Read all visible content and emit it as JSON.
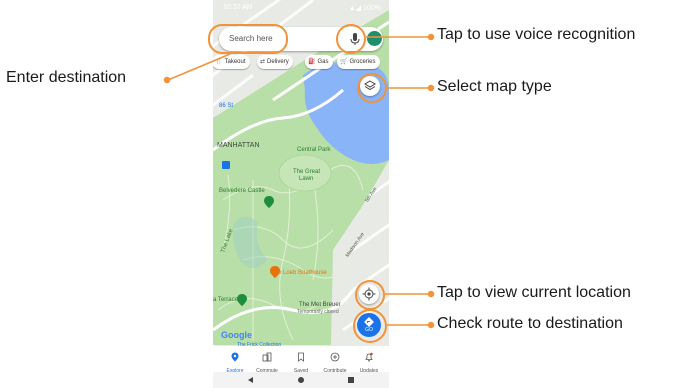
{
  "status_bar": {
    "time": "10:37 AM",
    "battery": "100%"
  },
  "search": {
    "placeholder": "Search here"
  },
  "chips": [
    {
      "icon": "restaurant-icon",
      "label": "Takeout"
    },
    {
      "icon": "delivery-icon",
      "label": "Delivery"
    },
    {
      "icon": "gas-icon",
      "label": "Gas"
    },
    {
      "icon": "grocery-icon",
      "label": "Groceries"
    }
  ],
  "map": {
    "street_86": "86 St",
    "manhattan": "MANHATTAN",
    "central_park": "Central Park",
    "great_lawn_1": "The Great",
    "great_lawn_2": "Lawn",
    "belvedere": "Belvedere Castle",
    "the_lake": "The Lake",
    "boathouse": "The Loeb Boathouse",
    "met_breuer_1": "The Met Breuer",
    "met_breuer_2": "Temporarily closed",
    "terrace": "a Terrace",
    "madison": "Madison Ave",
    "fifth_ave": "5th Ave",
    "google": "Google",
    "frick": "The Frick Collection"
  },
  "go_label": "GO",
  "bottom_nav": [
    {
      "label": "Explore",
      "icon": "explore-pin-icon",
      "active": true
    },
    {
      "label": "Commute",
      "icon": "commute-icon",
      "active": false
    },
    {
      "label": "Saved",
      "icon": "bookmark-icon",
      "active": false
    },
    {
      "label": "Contribute",
      "icon": "add-circle-icon",
      "active": false
    },
    {
      "label": "Updates",
      "icon": "bell-icon",
      "active": false
    }
  ],
  "callouts": {
    "voice": "Tap to use voice recognition",
    "destination": "Enter destination",
    "map_type": "Select map type",
    "current_location": "Tap to view current location",
    "route": "Check route to destination"
  },
  "colors": {
    "callout_accent": "#f19336",
    "park_green": "#b9dfa8",
    "water": "#8ab4f8",
    "brand_blue": "#1a73e8"
  }
}
